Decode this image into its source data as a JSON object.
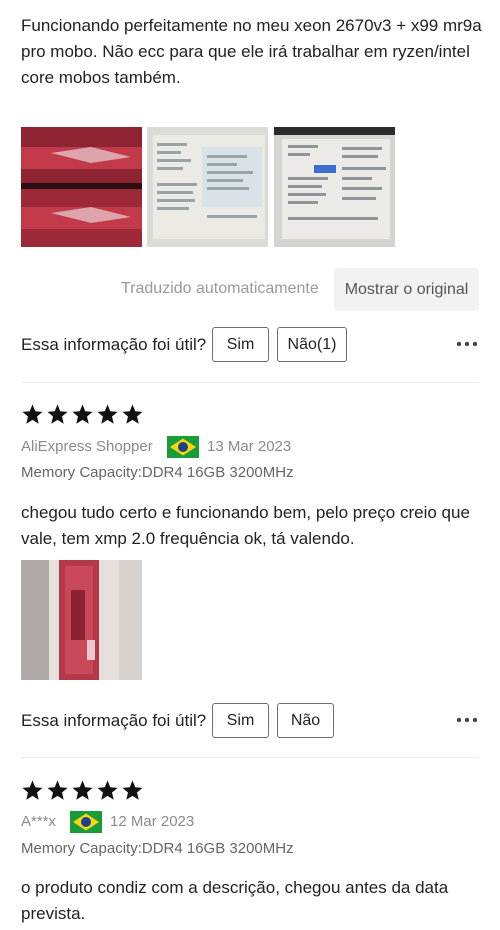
{
  "reviews": [
    {
      "text": "Funcionando perfeitamente no meu xeon 2670v3 + x99 mr9a pro mobo. Não ecc para que ele irá trabalhar em ryzen/intel core mobos também.",
      "photos": [
        "ram-photo",
        "bios-screenshot-photo",
        "bios-screenshot-photo"
      ],
      "translated_label": "Traduzido automaticamente",
      "show_original_label": "Mostrar o original",
      "helpful_question": "Essa informação foi útil?",
      "yes_label": "Sim",
      "no_label": "Não(1)"
    },
    {
      "rating": 5,
      "author": "AliExpress Shopper",
      "country_flag": "brazil-flag-icon",
      "date": "13 Mar 2023",
      "variant": "Memory Capacity:DDR4 16GB 3200MHz",
      "text": "chegou tudo certo e funcionando bem, pelo preço creio que vale, tem xmp 2.0 frequência ok, tá valendo.",
      "photos": [
        "ram-photo"
      ],
      "helpful_question": "Essa informação foi útil?",
      "yes_label": "Sim",
      "no_label": "Não"
    },
    {
      "rating": 5,
      "author": "A***x",
      "country_flag": "brazil-flag-icon",
      "date": "12 Mar 2023",
      "variant": "Memory Capacity:DDR4 16GB 3200MHz",
      "text": "o produto condiz com a descrição, chegou antes da data prevista."
    }
  ],
  "colors": {
    "star": "#111111",
    "muted_text": "#8a8a8a",
    "button_border": "#6e6e6e",
    "show_original_bg": "#f2f2f2",
    "ram_red": "#b32c3c"
  },
  "icons": {
    "more": "more-options-icon",
    "star": "star-icon"
  }
}
